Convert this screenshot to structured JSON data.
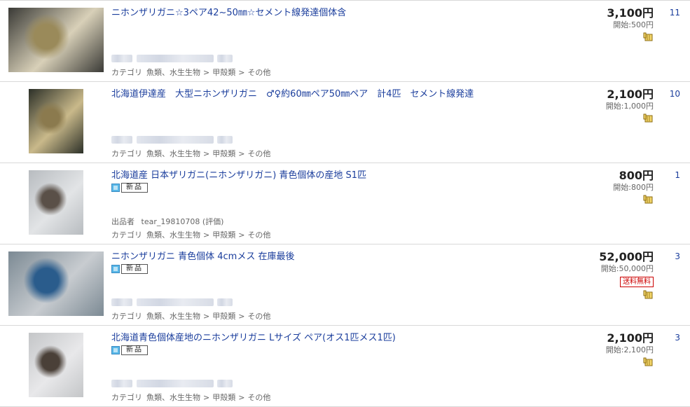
{
  "items": [
    {
      "title": "ニホンザリガニ☆3ペア42~50㎜☆セメント線発達個体含",
      "is_new": false,
      "new_label": "",
      "seller_label": "",
      "seller_name": "",
      "seller_rating": "",
      "category": [
        "カテゴリ",
        "魚類、水生生物",
        ">",
        "甲殻類",
        ">",
        "その他"
      ],
      "price": "3,100円",
      "start_price": "開始:500円",
      "free_shipping": "",
      "bids": "11",
      "thumb_palette": [
        "#3a3a36",
        "#9a8a5a",
        "#d8d0b8"
      ]
    },
    {
      "title": "北海道伊達産　大型ニホンザリガニ　♂♀約60㎜ペア50㎜ペア　計4匹　セメント線発達",
      "is_new": false,
      "new_label": "",
      "seller_label": "",
      "seller_name": "",
      "seller_rating": "",
      "category": [
        "カテゴリ",
        "魚類、水生生物",
        ">",
        "甲殻類",
        ">",
        "その他"
      ],
      "price": "2,100円",
      "start_price": "開始:1,000円",
      "free_shipping": "",
      "bids": "10",
      "thumb_palette": [
        "#2c3028",
        "#8b7a4e",
        "#c9b98a"
      ]
    },
    {
      "title": "北海道産 日本ザリガニ(ニホンザリガニ) 青色個体の産地 S1匹",
      "is_new": true,
      "new_label": "新品",
      "seller_label": "出品者",
      "seller_name": "tear_19810708",
      "seller_rating": "(評価)",
      "category": [
        "カテゴリ",
        "魚類、水生生物",
        ">",
        "甲殻類",
        ">",
        "その他"
      ],
      "price": "800円",
      "start_price": "開始:800円",
      "free_shipping": "",
      "bids": "1",
      "thumb_palette": [
        "#b8bcc0",
        "#5a5048",
        "#e2e4e6"
      ]
    },
    {
      "title": "ニホンザリガニ 青色個体 4cmメス 在庫最後",
      "is_new": true,
      "new_label": "新品",
      "seller_label": "",
      "seller_name": "",
      "seller_rating": "",
      "category": [
        "カテゴリ",
        "魚類、水生生物",
        ">",
        "甲殻類",
        ">",
        "その他"
      ],
      "price": "52,000円",
      "start_price": "開始:50,000円",
      "free_shipping": "送料無料",
      "bids": "3",
      "thumb_palette": [
        "#7c8a94",
        "#2a5c8c",
        "#c8ccd0"
      ]
    },
    {
      "title": "北海道青色個体産地のニホンザリガニ Lサイズ ペア(オス1匹メス1匹)",
      "is_new": true,
      "new_label": "新品",
      "seller_label": "",
      "seller_name": "",
      "seller_rating": "",
      "category": [
        "カテゴリ",
        "魚類、水生生物",
        ">",
        "甲殻類",
        ">",
        "その他"
      ],
      "price": "2,100円",
      "start_price": "開始:2,100円",
      "free_shipping": "",
      "bids": "3",
      "thumb_palette": [
        "#c4c6c8",
        "#4a4038",
        "#e8e8ea"
      ]
    }
  ],
  "icons": {
    "hand": "hand-pointer-icon",
    "new": "new-item-icon"
  },
  "colors": {
    "link": "#1a3d9c",
    "shipping": "#cc0000",
    "border": "#d8d8d8"
  }
}
